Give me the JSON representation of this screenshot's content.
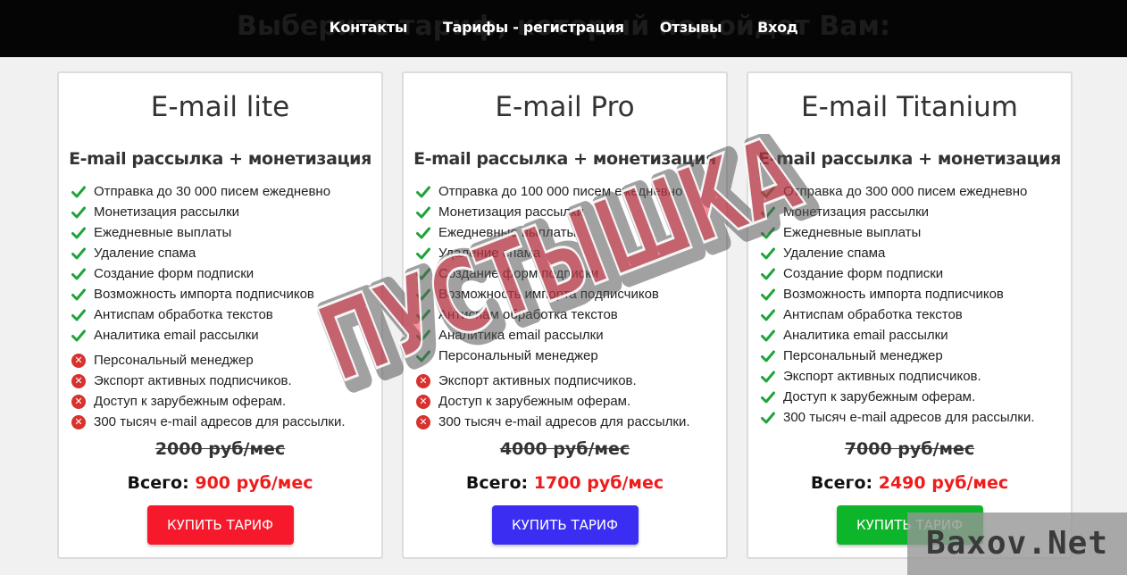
{
  "page": {
    "background_heading": "Выберите тариф, который подойдет Вам:"
  },
  "nav": {
    "items": [
      {
        "label": "Контакты"
      },
      {
        "label": "Тарифы - регистрация"
      },
      {
        "label": "Отзывы"
      },
      {
        "label": "Вход"
      }
    ]
  },
  "plans": [
    {
      "title": "E-mail lite",
      "subtitle": "E-mail рассылка + монетизация",
      "features": [
        {
          "text": "Отправка до 30 000 писем ежедневно",
          "included": true
        },
        {
          "text": "Монетизация рассылки",
          "included": true
        },
        {
          "text": "Ежедневные выплаты",
          "included": true
        },
        {
          "text": "Удаление спама",
          "included": true
        },
        {
          "text": "Создание форм подписки",
          "included": true
        },
        {
          "text": "Возможность импорта подписчиков",
          "included": true
        },
        {
          "text": "Антиспам обработка текстов",
          "included": true
        },
        {
          "text": "Аналитика email рассылки",
          "included": true
        },
        {
          "text": "Персональный менеджер",
          "included": false
        },
        {
          "text": "Экспорт активных подписчиков.",
          "included": false
        },
        {
          "text": "Доступ к зарубежным оферам.",
          "included": false
        },
        {
          "text": "300 тысяч e-mail адресов для рассылки.",
          "included": false
        }
      ],
      "old_price": "2000 руб/мес",
      "total_label": "Всего:",
      "price": "900 руб/мес",
      "button_label": "КУПИТЬ ТАРИФ",
      "button_color": "#f5192b"
    },
    {
      "title": "E-mail Pro",
      "subtitle": "E-mail рассылка + монетизация",
      "features": [
        {
          "text": "Отправка до 100 000 писем ежедневно",
          "included": true
        },
        {
          "text": "Монетизация рассылки",
          "included": true
        },
        {
          "text": "Ежедневные выплаты",
          "included": true
        },
        {
          "text": "Удаление спама",
          "included": true
        },
        {
          "text": "Создание форм подписки",
          "included": true
        },
        {
          "text": "Возможность импорта подписчиков",
          "included": true
        },
        {
          "text": "Антиспам обработка текстов",
          "included": true
        },
        {
          "text": "Аналитика email рассылки",
          "included": true
        },
        {
          "text": "Персональный менеджер",
          "included": true
        },
        {
          "text": "Экспорт активных подписчиков.",
          "included": false
        },
        {
          "text": "Доступ к зарубежным оферам.",
          "included": false
        },
        {
          "text": "300 тысяч e-mail адресов для рассылки.",
          "included": false
        }
      ],
      "old_price": "4000 руб/мес",
      "total_label": "Всего:",
      "price": "1700 руб/мес",
      "button_label": "КУПИТЬ ТАРИФ",
      "button_color": "#3b2ef2"
    },
    {
      "title": "E-mail Titanium",
      "subtitle": "E-mail рассылка + монетизация",
      "features": [
        {
          "text": "Отправка до 300 000 писем ежедневно",
          "included": true
        },
        {
          "text": "Монетизация рассылки",
          "included": true
        },
        {
          "text": "Ежедневные выплаты",
          "included": true
        },
        {
          "text": "Удаление спама",
          "included": true
        },
        {
          "text": "Создание форм подписки",
          "included": true
        },
        {
          "text": "Возможность импорта подписчиков",
          "included": true
        },
        {
          "text": "Антиспам обработка текстов",
          "included": true
        },
        {
          "text": "Аналитика email рассылки",
          "included": true
        },
        {
          "text": "Персональный менеджер",
          "included": true
        },
        {
          "text": "Экспорт активных подписчиков.",
          "included": true
        },
        {
          "text": "Доступ к зарубежным оферам.",
          "included": true
        },
        {
          "text": "300 тысяч e-mail адресов для рассылки.",
          "included": true
        }
      ],
      "old_price": "7000 руб/мес",
      "total_label": "Всего:",
      "price": "2490 руб/мес",
      "button_label": "КУПИТЬ ТАРИФ",
      "button_color": "#0db52a"
    }
  ],
  "stamp": {
    "text": "ПУСТЫШКА",
    "color": "#e8253a"
  },
  "watermark": {
    "text": "Baxov.Net"
  },
  "colors": {
    "check": "#1fa33b",
    "cross": "#d7322e",
    "price_red": "#ef1c1c"
  }
}
